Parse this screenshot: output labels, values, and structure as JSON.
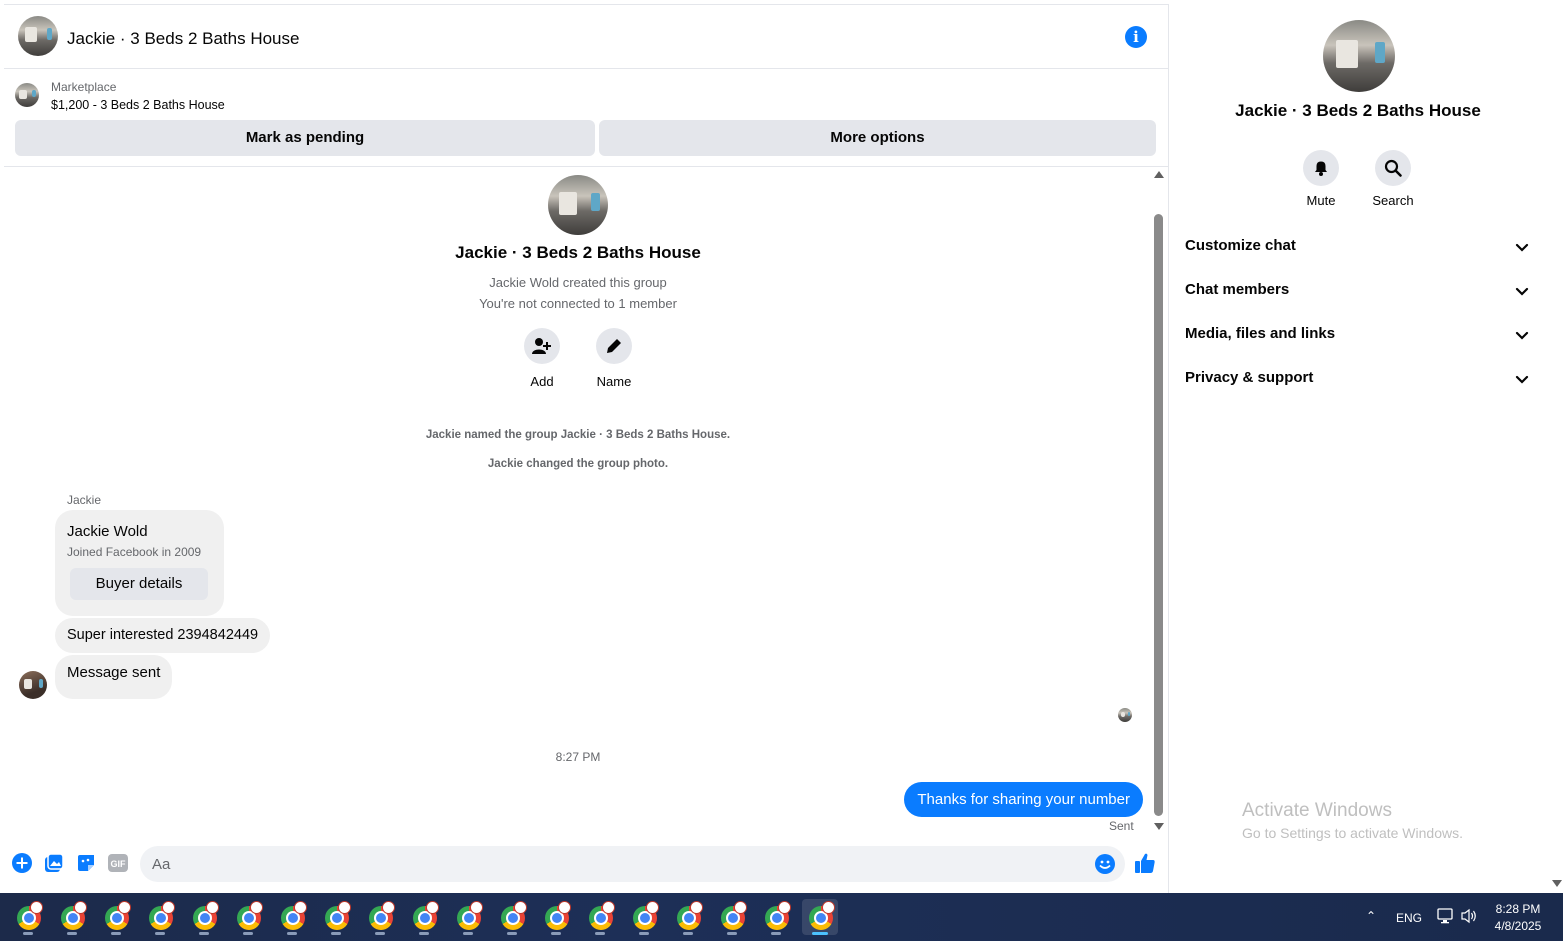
{
  "header": {
    "title": "Jackie · 3 Beds 2 Baths House",
    "info_icon": "info-icon"
  },
  "listing": {
    "source": "Marketplace",
    "price_title": "$1,200 - 3 Beds 2 Baths House",
    "pending_label": "Mark as pending",
    "options_label": "More options"
  },
  "intro": {
    "title": "Jackie · 3 Beds 2 Baths House",
    "created": "Jackie Wold created this group",
    "connected": "You're not connected to 1 member",
    "add_label": "Add",
    "name_label": "Name"
  },
  "system_messages": {
    "named": "Jackie named the group Jackie · 3 Beds 2 Baths House.",
    "photo": "Jackie changed the group photo."
  },
  "messages": {
    "sender_label": "Jackie",
    "card": {
      "name": "Jackie Wold",
      "joined": "Joined Facebook in 2009",
      "button": "Buyer details"
    },
    "incoming_1": "Super interested 2394842449",
    "incoming_2": "Message sent",
    "timestamp": "8:27 PM",
    "outgoing_1": "Thanks for sharing your number",
    "sent_status": "Sent"
  },
  "composer": {
    "placeholder": "Aa",
    "value": "",
    "gif_label": "GIF"
  },
  "details": {
    "title": "Jackie · 3 Beds 2 Baths House",
    "mute_label": "Mute",
    "search_label": "Search",
    "sections": [
      "Customize chat",
      "Chat members",
      "Media, files and links",
      "Privacy & support"
    ]
  },
  "watermark": {
    "title": "Activate Windows",
    "subtitle": "Go to Settings to activate Windows."
  },
  "taskbar": {
    "app_icon": "chrome-icon",
    "app_count": 19,
    "language": "ENG",
    "time": "8:28 PM",
    "date": "4/8/2025"
  },
  "colors": {
    "accent": "#0a7cff",
    "bubble_in": "#f0f0f0",
    "button_gray": "#e4e6eb",
    "secondary_text": "#65676b",
    "taskbar": "#1d2f57"
  }
}
